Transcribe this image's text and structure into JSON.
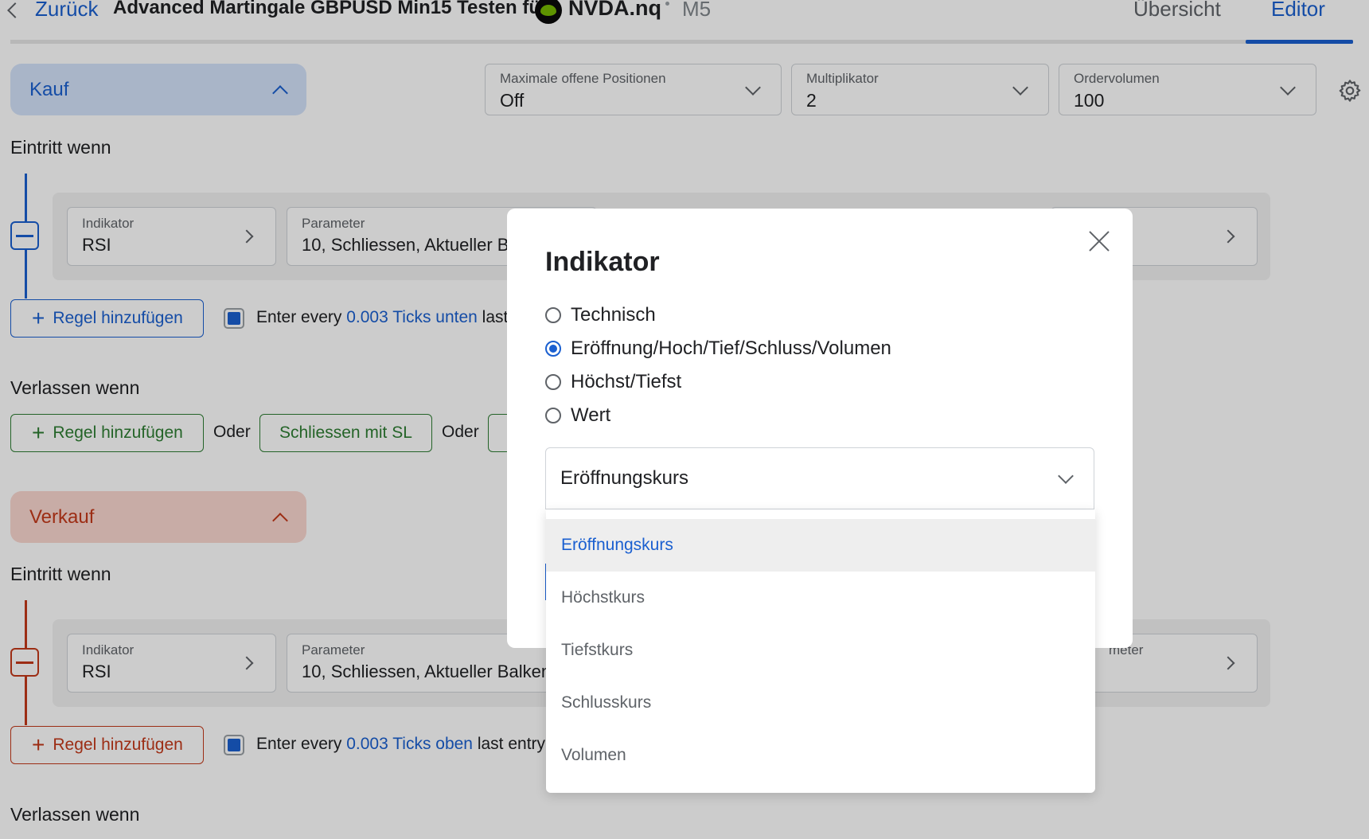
{
  "header": {
    "back_label": "Zurück",
    "title": "Advanced Martingale GBPUSD Min15 Testen für",
    "symbol": "NVDA.nq",
    "timeframe": "M5",
    "tabs": [
      "Übersicht",
      "Editor"
    ],
    "active_tab": "Editor"
  },
  "settings": {
    "max_positions": {
      "label": "Maximale offene Positionen",
      "value": "Off"
    },
    "multiplier": {
      "label": "Multiplikator",
      "value": "2"
    },
    "order_volume": {
      "label": "Ordervolumen",
      "value": "100"
    }
  },
  "buy": {
    "toggle_label": "Kauf",
    "entry_heading": "Eintritt wenn",
    "indicator": {
      "label": "Indikator",
      "value": "RSI"
    },
    "parameter": {
      "label": "Parameter",
      "value": "10, Schliessen, Aktueller Ba"
    },
    "add_rule_label": "Regel hinzufügen",
    "enter_every": {
      "prefix": "Enter every ",
      "link": "0.003 Ticks unten",
      "suffix": " last"
    },
    "exit_heading": "Verlassen wenn",
    "exit_add_rule_label": "Regel hinzufügen",
    "or_label": "Oder",
    "close_with_sl_label": "Schliessen mit SL"
  },
  "sell": {
    "toggle_label": "Verkauf",
    "entry_heading": "Eintritt wenn",
    "indicator": {
      "label": "Indikator",
      "value": "RSI"
    },
    "parameter": {
      "label": "Parameter",
      "value": "10, Schliessen, Aktueller Balken"
    },
    "parameter_right_label": "meter",
    "add_rule_label": "Regel hinzufügen",
    "enter_every": {
      "prefix": "Enter every ",
      "link": "0.003 Ticks oben",
      "suffix": " last entry"
    },
    "exit_heading": "Verlassen wenn"
  },
  "modal": {
    "title": "Indikator",
    "options": [
      "Technisch",
      "Eröffnung/Hoch/Tief/Schluss/Volumen",
      "Höchst/Tiefst",
      "Wert"
    ],
    "selected_option": "Eröffnung/Hoch/Tief/Schluss/Volumen",
    "select_value": "Eröffnungskurs",
    "dropdown_items": [
      "Eröffnungskurs",
      "Höchstkurs",
      "Tiefstkurs",
      "Schlusskurs",
      "Volumen"
    ],
    "selected_item": "Eröffnungskurs"
  },
  "colors": {
    "accent_blue": "#1a5fd0",
    "buy_bg": "#d4e3fb",
    "sell_bg": "#fbd7d0",
    "sell_red": "#c4391a",
    "exit_green": "#2e7d32"
  }
}
